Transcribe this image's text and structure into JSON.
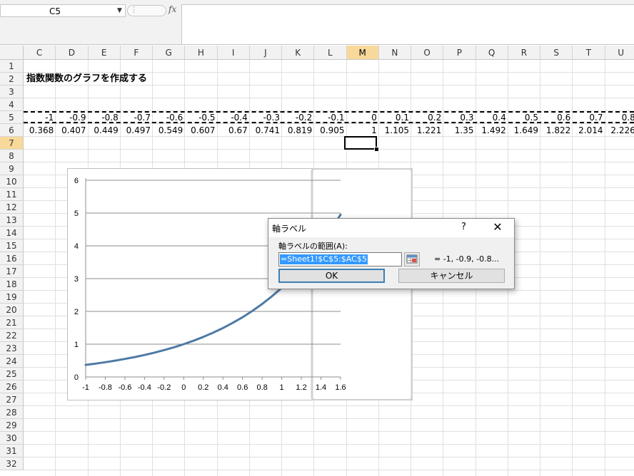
{
  "formula_bar": {
    "name_box": "C5",
    "fx_label": "fx",
    "formula": ""
  },
  "columns": [
    {
      "label": "C",
      "active": false
    },
    {
      "label": "D",
      "active": false
    },
    {
      "label": "E",
      "active": false
    },
    {
      "label": "F",
      "active": false
    },
    {
      "label": "G",
      "active": false
    },
    {
      "label": "H",
      "active": false
    },
    {
      "label": "I",
      "active": false
    },
    {
      "label": "J",
      "active": false
    },
    {
      "label": "K",
      "active": false
    },
    {
      "label": "L",
      "active": false
    },
    {
      "label": "M",
      "active": true
    },
    {
      "label": "N",
      "active": false
    },
    {
      "label": "O",
      "active": false
    },
    {
      "label": "P",
      "active": false
    },
    {
      "label": "Q",
      "active": false
    },
    {
      "label": "R",
      "active": false
    },
    {
      "label": "S",
      "active": false
    },
    {
      "label": "T",
      "active": false
    },
    {
      "label": "U",
      "active": false
    }
  ],
  "rows": [
    "1",
    "2",
    "3",
    "4",
    "5",
    "6",
    "7",
    "8",
    "9",
    "10",
    "11",
    "12",
    "13",
    "14",
    "15",
    "16",
    "17",
    "18",
    "19",
    "20",
    "21",
    "22",
    "23",
    "24",
    "25",
    "26",
    "27",
    "28",
    "29",
    "30",
    "31",
    "32"
  ],
  "active_row": "7",
  "sheet": {
    "title": "指数関数のグラフを作成する",
    "row5": [
      "-1",
      "-0.9",
      "-0.8",
      "-0.7",
      "-0.6",
      "-0.5",
      "-0.4",
      "-0.3",
      "-0.2",
      "-0.1",
      "0",
      "0.1",
      "0.2",
      "0.3",
      "0.4",
      "0.5",
      "0.6",
      "0.7",
      "0.8"
    ],
    "row6": [
      "0.368",
      "0.407",
      "0.449",
      "0.497",
      "0.549",
      "0.607",
      "0.67",
      "0.741",
      "0.819",
      "0.905",
      "1",
      "1.105",
      "1.221",
      "1.35",
      "1.492",
      "1.649",
      "1.822",
      "2.014",
      "2.226"
    ]
  },
  "chart_data": {
    "type": "line",
    "x": [
      -1,
      -0.9,
      -0.8,
      -0.7,
      -0.6,
      -0.5,
      -0.4,
      -0.3,
      -0.2,
      -0.1,
      0,
      0.1,
      0.2,
      0.3,
      0.4,
      0.5,
      0.6,
      0.7,
      0.8,
      0.9,
      1,
      1.1,
      1.2,
      1.3,
      1.4,
      1.5,
      1.6
    ],
    "series": [
      {
        "values": [
          0.368,
          0.407,
          0.449,
          0.497,
          0.549,
          0.607,
          0.67,
          0.741,
          0.819,
          0.905,
          1,
          1.105,
          1.221,
          1.35,
          1.492,
          1.649,
          1.822,
          2.014,
          2.226,
          2.46,
          2.718,
          3.004,
          3.32,
          3.669,
          4.055,
          4.482,
          4.953
        ],
        "color": "#4e7aa5"
      }
    ],
    "x_ticks": [
      "-1",
      "-0.8",
      "-0.6",
      "-0.4",
      "-0.2",
      "0",
      "0.2",
      "0.4",
      "0.6",
      "0.8",
      "1",
      "1.2",
      "1.4",
      "1.6"
    ],
    "y_ticks": [
      "0",
      "1",
      "2",
      "3",
      "4",
      "5",
      "6"
    ],
    "xlim": [
      -1,
      1.6
    ],
    "ylim": [
      0,
      6
    ],
    "grid": true,
    "legend": "none"
  },
  "dialog": {
    "title": "軸ラベル",
    "help": "?",
    "close": "✕",
    "range_label": "軸ラベルの範囲(A):",
    "range_value": "=Sheet1!$C$5:$AC$5",
    "preview": "= -1, -0.9, -0.8...",
    "ok": "OK",
    "cancel": "キャンセル"
  },
  "colors": {
    "line": "#4e7aa5",
    "active_header": "#f9d99a",
    "selection": "#3399ff"
  }
}
